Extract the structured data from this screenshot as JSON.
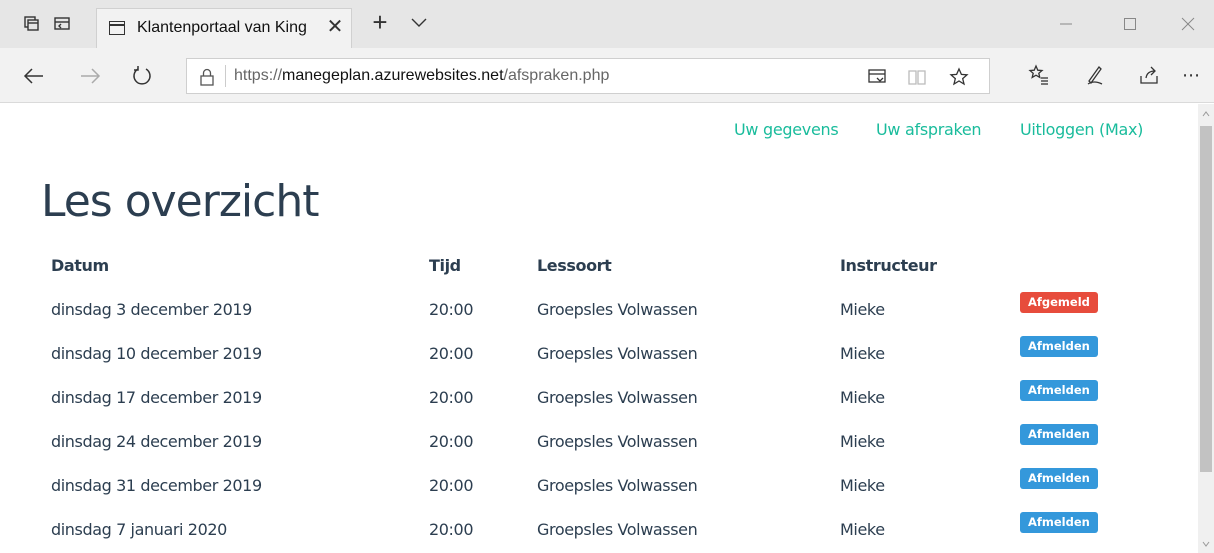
{
  "browser": {
    "tab_title": "Klantenportaal van King",
    "tab_close": "✕",
    "new_tab": "+",
    "url_scheme": "https://",
    "url_host": "manegeplan.azurewebsites.net",
    "url_path": "/afspraken.php"
  },
  "nav": {
    "links": [
      "Uw gegevens",
      "Uw afspraken",
      "Uitloggen (Max)"
    ]
  },
  "page": {
    "title": "Les overzicht"
  },
  "table": {
    "headers": [
      "Datum",
      "Tijd",
      "Lessoort",
      "Instructeur"
    ],
    "rows": [
      {
        "datum": "dinsdag 3 december 2019",
        "tijd": "20:00",
        "lessoort": "Groepsles Volwassen",
        "instructeur": "Mieke",
        "action": "Afgemeld"
      },
      {
        "datum": "dinsdag 10 december 2019",
        "tijd": "20:00",
        "lessoort": "Groepsles Volwassen",
        "instructeur": "Mieke",
        "action": "Afmelden"
      },
      {
        "datum": "dinsdag 17 december 2019",
        "tijd": "20:00",
        "lessoort": "Groepsles Volwassen",
        "instructeur": "Mieke",
        "action": "Afmelden"
      },
      {
        "datum": "dinsdag 24 december 2019",
        "tijd": "20:00",
        "lessoort": "Groepsles Volwassen",
        "instructeur": "Mieke",
        "action": "Afmelden"
      },
      {
        "datum": "dinsdag 31 december 2019",
        "tijd": "20:00",
        "lessoort": "Groepsles Volwassen",
        "instructeur": "Mieke",
        "action": "Afmelden"
      },
      {
        "datum": "dinsdag 7 januari 2020",
        "tijd": "20:00",
        "lessoort": "Groepsles Volwassen",
        "instructeur": "Mieke",
        "action": "Afmelden"
      }
    ]
  },
  "colors": {
    "accent": "#1abc9c",
    "text": "#2c3e50",
    "badge_cancelled": "#e74c3c",
    "badge_action": "#3498db"
  }
}
